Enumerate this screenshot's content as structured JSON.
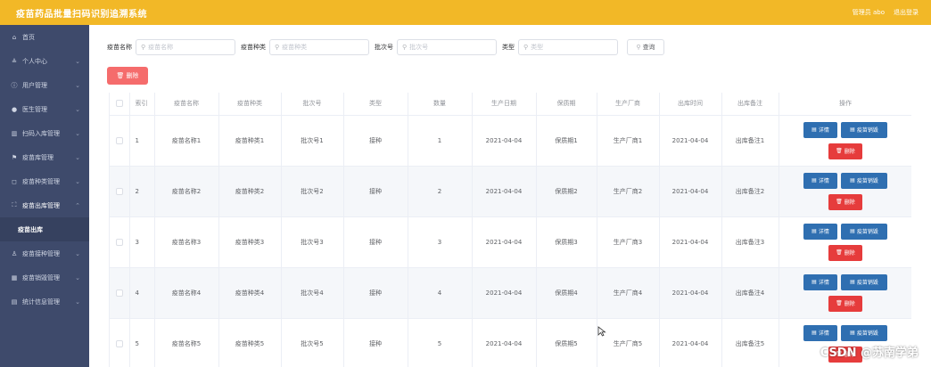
{
  "header": {
    "title": "疫苗药品批量扫码识别追溯系统",
    "admin_label": "管理员 abo",
    "logout_label": "退出登录"
  },
  "sidebar": {
    "items": [
      {
        "label": "首页",
        "icon": "home-icon",
        "has_children": false
      },
      {
        "label": "个人中心",
        "icon": "user-icon",
        "has_children": true
      },
      {
        "label": "用户管理",
        "icon": "info-icon",
        "has_children": true
      },
      {
        "label": "医生管理",
        "icon": "pin-icon",
        "has_children": true
      },
      {
        "label": "扫码入库管理",
        "icon": "barcode-icon",
        "has_children": true
      },
      {
        "label": "疫苗库管理",
        "icon": "flag-icon",
        "has_children": true
      },
      {
        "label": "疫苗种类管理",
        "icon": "square-icon",
        "has_children": true
      },
      {
        "label": "疫苗出库管理",
        "icon": "outbox-icon",
        "has_children": true,
        "expanded": true
      }
    ],
    "active_sub": "疫苗出库",
    "items_after": [
      {
        "label": "疫苗接种管理",
        "icon": "person-icon",
        "has_children": true
      },
      {
        "label": "疫苗销毁管理",
        "icon": "grid-icon",
        "has_children": true
      },
      {
        "label": "统计信息管理",
        "icon": "stats-icon",
        "has_children": true
      }
    ]
  },
  "search": {
    "fields": [
      {
        "label": "疫苗名称",
        "placeholder": "疫苗名称"
      },
      {
        "label": "疫苗种类",
        "placeholder": "疫苗种类"
      },
      {
        "label": "批次号",
        "placeholder": "批次号"
      },
      {
        "label": "类型",
        "placeholder": "类型"
      }
    ],
    "button_label": "查询"
  },
  "actions": {
    "delete_label": "删除"
  },
  "table": {
    "headers": [
      "索引",
      "疫苗名称",
      "疫苗种类",
      "批次号",
      "类型",
      "数量",
      "生产日期",
      "保质期",
      "生产厂商",
      "出库时间",
      "出库备注",
      "操作"
    ],
    "rows": [
      [
        "1",
        "疫苗名称1",
        "疫苗种类1",
        "批次号1",
        "接种",
        "1",
        "2021-04-04",
        "保质期1",
        "生产厂商1",
        "2021-04-04",
        "出库备注1"
      ],
      [
        "2",
        "疫苗名称2",
        "疫苗种类2",
        "批次号2",
        "接种",
        "2",
        "2021-04-04",
        "保质期2",
        "生产厂商2",
        "2021-04-04",
        "出库备注2"
      ],
      [
        "3",
        "疫苗名称3",
        "疫苗种类3",
        "批次号3",
        "接种",
        "3",
        "2021-04-04",
        "保质期3",
        "生产厂商3",
        "2021-04-04",
        "出库备注3"
      ],
      [
        "4",
        "疫苗名称4",
        "疫苗种类4",
        "批次号4",
        "接种",
        "4",
        "2021-04-04",
        "保质期4",
        "生产厂商4",
        "2021-04-04",
        "出库备注4"
      ],
      [
        "5",
        "疫苗名称5",
        "疫苗种类5",
        "批次号5",
        "接种",
        "5",
        "2021-04-04",
        "保质期5",
        "生产厂商5",
        "2021-04-04",
        "出库备注5"
      ]
    ],
    "op_labels": {
      "detail": "详情",
      "destroy": "疫苗销毁",
      "delete": "删除"
    }
  },
  "watermark": "CSDN @苏南学弟",
  "colors": {
    "header": "#f2b827",
    "sidebar": "#3e4a6b",
    "primary": "#2f6fb1",
    "danger": "#e63c3c"
  }
}
